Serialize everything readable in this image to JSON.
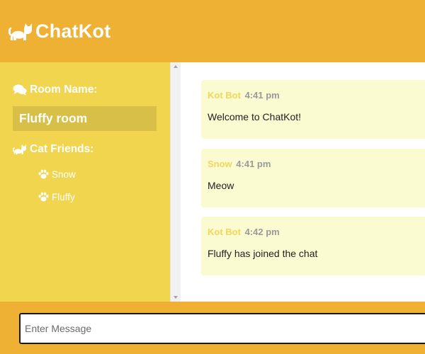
{
  "app": {
    "title": "ChatKot",
    "logo_icon": "cat-icon"
  },
  "sidebar": {
    "room_heading": "Room Name:",
    "room_heading_icon": "chat-bubbles-icon",
    "room_name": "Fluffy room",
    "friends_heading": "Cat Friends:",
    "friends_heading_icon": "cat-icon",
    "friends": [
      {
        "name": "Snow",
        "icon": "paw-icon"
      },
      {
        "name": "Fluffy",
        "icon": "paw-icon"
      }
    ]
  },
  "messages": [
    {
      "author": "Kot Bot",
      "time": "4:41 pm",
      "text": "Welcome to ChatKot!"
    },
    {
      "author": "Snow",
      "time": "4:41 pm",
      "text": "Meow"
    },
    {
      "author": "Kot Bot",
      "time": "4:42 pm",
      "text": "Fluffy has joined the chat"
    }
  ],
  "composer": {
    "placeholder": "Enter Message"
  },
  "colors": {
    "header_bg": "#efb134",
    "sidebar_bg": "#f1d54e",
    "room_box_bg": "#d7bf48",
    "message_bg": "#fafbd0",
    "author_color": "#f2d65b",
    "time_color": "#9a9a9a"
  }
}
